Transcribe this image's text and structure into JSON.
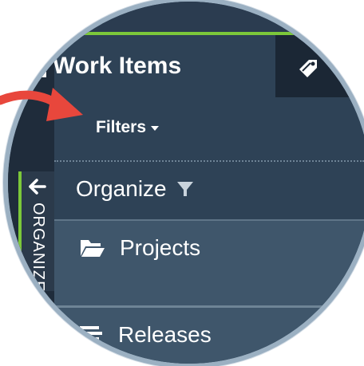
{
  "header": {
    "title": "Work Items",
    "title_icon": "list-icon",
    "second_tab_icon": "tag-icon"
  },
  "filters": {
    "label": "Filters",
    "icon": "caret-down-icon"
  },
  "organize": {
    "label": "Organize",
    "icon": "funnel-icon"
  },
  "sidebar": {
    "collapsed_label": "ORGANIZE",
    "back_icon": "arrow-left-icon",
    "items": [
      {
        "label": "Projects",
        "icon": "folder-open-icon"
      },
      {
        "label": "Releases",
        "icon": "release-icon"
      }
    ]
  },
  "annotation": {
    "icon": "red-pointer-arrow",
    "color": "#e8473c"
  },
  "colors": {
    "accent": "#7cc83a",
    "panel": "#2e4256",
    "section": "#3f566b",
    "dark": "#1b2735"
  }
}
